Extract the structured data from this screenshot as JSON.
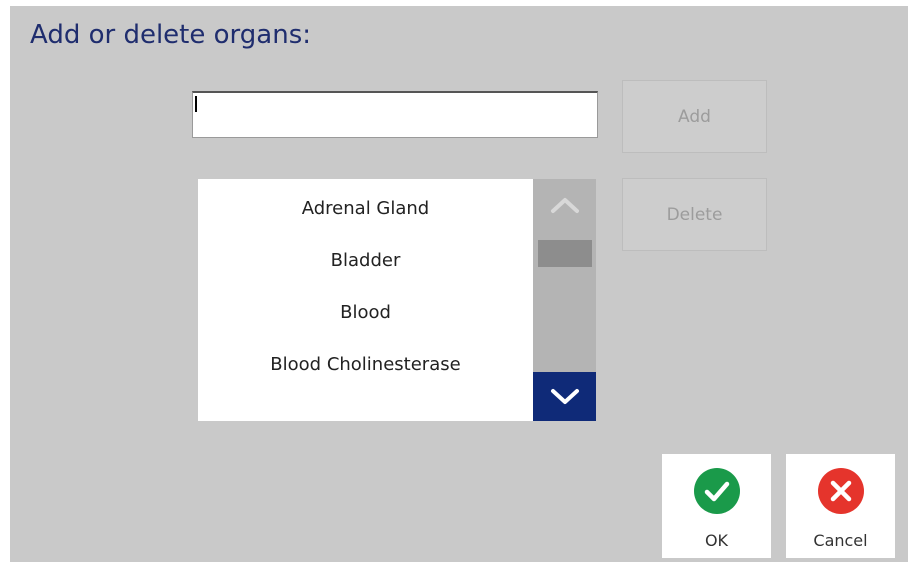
{
  "dialog": {
    "title": "Add or delete organs:"
  },
  "input": {
    "value": ""
  },
  "buttons": {
    "add_label": "Add",
    "delete_label": "Delete",
    "ok_label": "OK",
    "cancel_label": "Cancel"
  },
  "organs": [
    "Adrenal Gland",
    "Bladder",
    "Blood",
    "Blood Cholinesterase"
  ],
  "icons": {
    "scroll_up": "chevron-up-icon",
    "scroll_down": "chevron-down-icon",
    "ok": "check-circle-icon",
    "cancel": "x-circle-icon"
  },
  "colors": {
    "title": "#1f2d6e",
    "scroll_down_bg": "#0f2a78",
    "ok_green": "#1a9a4a",
    "cancel_red": "#e5342c",
    "disabled_text": "#9c9c9c"
  }
}
